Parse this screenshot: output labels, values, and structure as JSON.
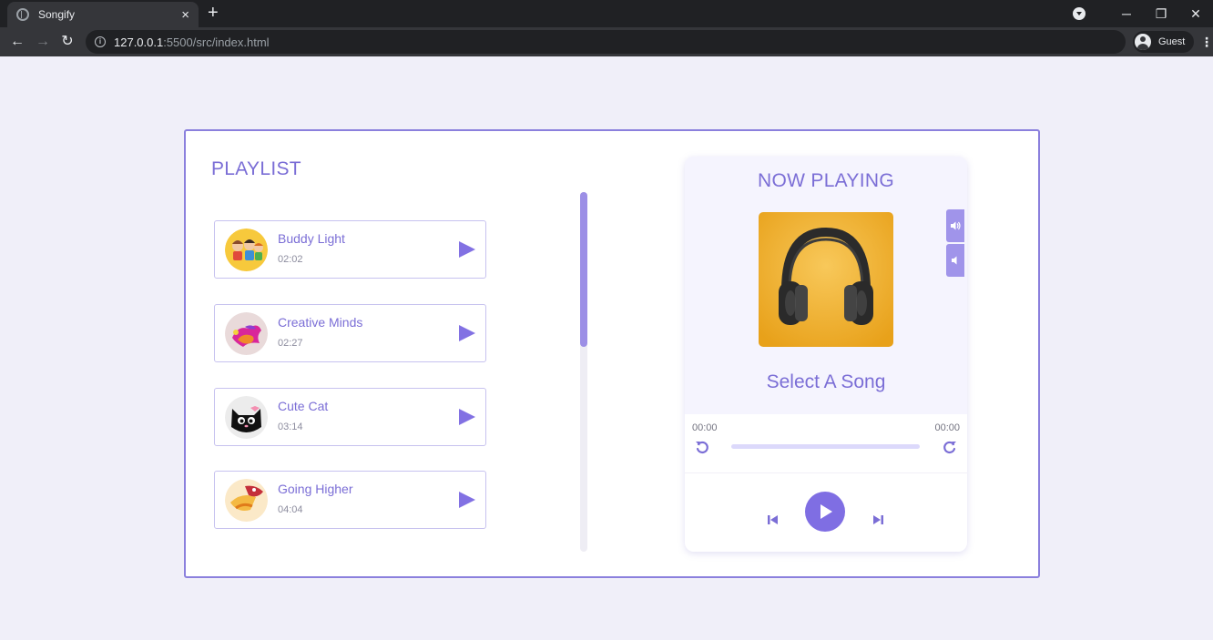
{
  "browser": {
    "tab_title": "Songify",
    "tab_close": "×",
    "new_tab": "+",
    "url_host": "127.0.0.1",
    "url_path": ":5500/src/index.html",
    "profile_name": "Guest",
    "minimize": "─",
    "restore": "❐",
    "close": "✕",
    "back": "←",
    "forward": "→",
    "reload": "↻",
    "menu": "⋮",
    "info": "i"
  },
  "playlist": {
    "title": "PLAYLIST",
    "songs": [
      {
        "name": "Buddy Light",
        "duration": "02:02",
        "icon": "kids-cartoon-art"
      },
      {
        "name": "Creative Minds",
        "duration": "02:27",
        "icon": "paint-splash-art"
      },
      {
        "name": "Cute Cat",
        "duration": "03:14",
        "icon": "black-cat-art"
      },
      {
        "name": "Going Higher",
        "duration": "04:04",
        "icon": "food-art"
      }
    ]
  },
  "player": {
    "title": "NOW PLAYING",
    "status": "Select A Song",
    "current_time": "00:00",
    "total_time": "00:00",
    "progress": 0
  },
  "colors": {
    "accent": "#7b6ed6",
    "button": "#7f6ee3",
    "background": "#f0eff9"
  }
}
